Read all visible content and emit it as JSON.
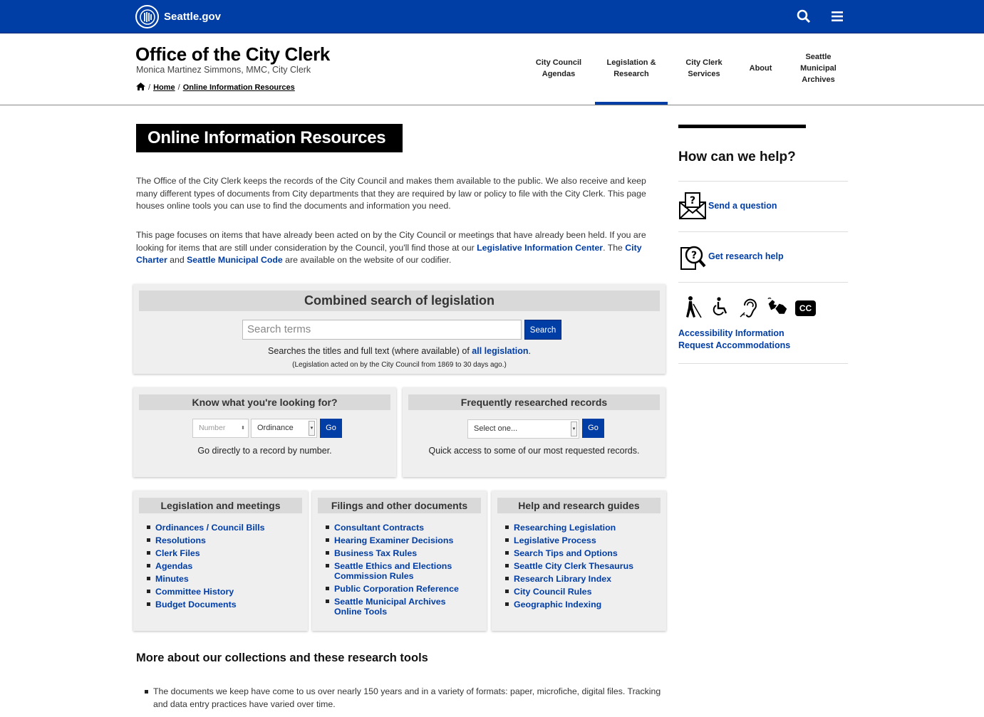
{
  "topbar": {
    "logo_text": "Seattle.gov",
    "search_icon": "search-icon",
    "menu_icon": "hamburger-menu-icon"
  },
  "header": {
    "title": "Office of the City Clerk",
    "subtitle": "Monica Martinez Simmons, MMC, City Clerk",
    "breadcrumb": [
      "Home",
      "Online Information Resources"
    ],
    "nav": [
      {
        "label": "City Council\nAgendas"
      },
      {
        "label": "Legislation &\nResearch",
        "active": true
      },
      {
        "label": "City Clerk\nServices"
      },
      {
        "label": "About"
      },
      {
        "label": "Seattle\nMunicipal\nArchives"
      }
    ]
  },
  "main": {
    "page_title": "Online Information Resources",
    "intro1": "The Office of the City Clerk keeps the records of the City Council and makes them available to the public. We also receive and keep many different types of documents from City departments that they are required by law or policy to file with the City Clerk. This page houses online tools you can use to find the documents and information you need.",
    "intro2_a": "This page focuses on items that have already been acted on by the City Council or meetings that have already been held. If you are looking for items that are still under consideration by the Council, you'll find those at our ",
    "intro2_link1": "Legislative Information Center",
    "intro2_b": ". The ",
    "intro2_link2": "City Charter",
    "intro2_c": " and ",
    "intro2_link3": "Seattle Municipal Code",
    "intro2_d": " are available on the website of our codifier."
  },
  "combined_search": {
    "heading": "Combined search of legislation",
    "placeholder": "Search terms",
    "button": "Search",
    "note_a": "Searches the titles and full text (where available) of ",
    "note_link": "all legislation",
    "note_b": ".",
    "note2": "(Legislation acted on by the City Council from 1869 to 30 days ago.)"
  },
  "know": {
    "heading": "Know what you're looking for?",
    "number_placeholder": "Number",
    "type_value": "Ordinance",
    "go": "Go",
    "desc": "Go directly to a record by number."
  },
  "frequent": {
    "heading": "Frequently researched records",
    "select_value": "Select one...",
    "go": "Go",
    "desc": "Quick access to some of our most requested records."
  },
  "columns": [
    {
      "heading": "Legislation and meetings",
      "links": [
        "Ordinances / Council Bills",
        "Resolutions",
        "Clerk Files",
        "Agendas",
        "Minutes",
        "Committee History",
        "Budget Documents"
      ]
    },
    {
      "heading": "Filings and other documents",
      "links": [
        "Consultant Contracts",
        "Hearing Examiner Decisions",
        "Business Tax Rules",
        "Seattle Ethics and Elections Commission Rules",
        "Public Corporation Reference",
        "Seattle Municipal Archives Online Tools"
      ]
    },
    {
      "heading": "Help and research guides",
      "links": [
        "Researching Legislation",
        "Legislative Process",
        "Search Tips and Options",
        "Seattle City Clerk Thesaurus",
        "Research Library Index",
        "City Council Rules",
        "Geographic Indexing"
      ]
    }
  ],
  "more": {
    "heading": "More about our collections and these research tools",
    "items": [
      "The documents we keep have come to us over nearly 150 years and in a variety of formats: paper, microfiche, digital files. Tracking and data entry practices have varied over time."
    ]
  },
  "sidebar": {
    "heading": "How can we help?",
    "send_question": "Send a question",
    "research_help": "Get research help",
    "cc_label": "CC",
    "accessibility_link": "Accessibility Information",
    "accommodations_link": "Request Accommodations"
  }
}
